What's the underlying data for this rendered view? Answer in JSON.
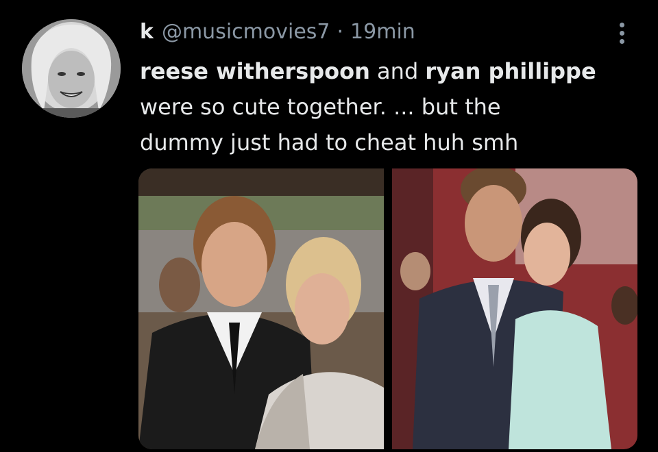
{
  "tweet": {
    "display_name": "k",
    "handle": "@musicmovies7",
    "separator": "·",
    "time": "19min",
    "more_icon": "more-vertical-icon",
    "text_line1_bold1": "reese witherspoon",
    "text_line1_plain": " and ",
    "text_line1_bold2": "ryan phillippe",
    "text_line2": "were so cute together. ... but the",
    "text_line3": "dummy just had to cheat huh smh"
  },
  "colors": {
    "background": "#000000",
    "text_primary": "#e7e9ea",
    "text_secondary": "#8b98a5"
  },
  "media": {
    "photo_count": 2
  }
}
